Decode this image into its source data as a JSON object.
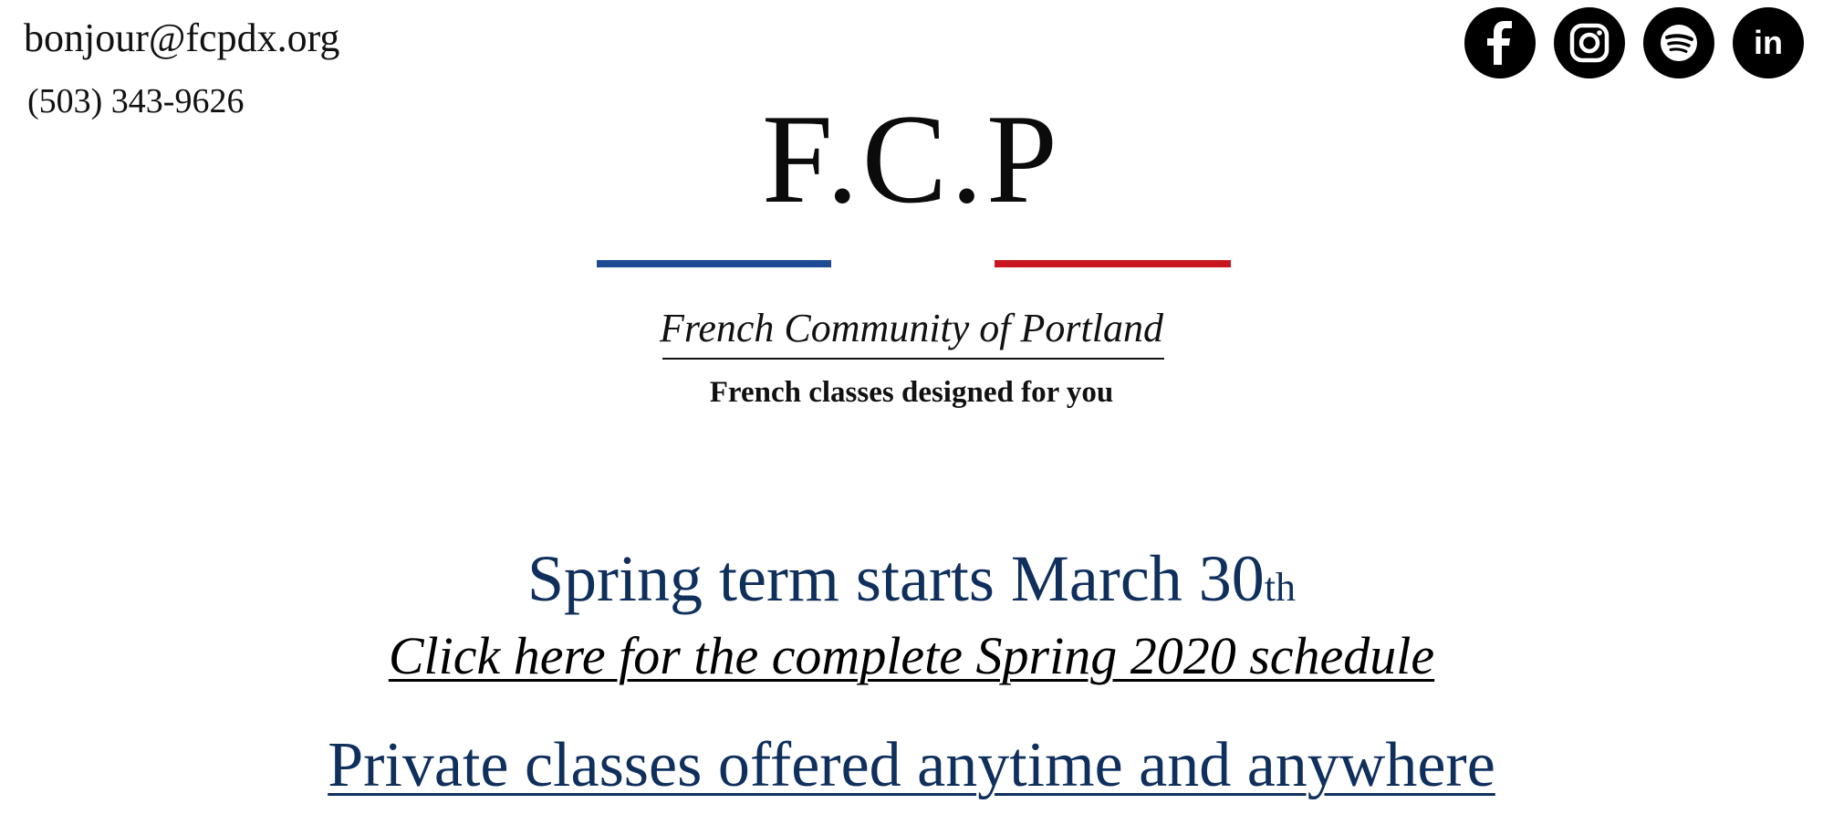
{
  "contact": {
    "email": "bonjour@fcpdx.org",
    "phone": "(503) 343-9626"
  },
  "social": {
    "icons": [
      "facebook-icon",
      "instagram-icon",
      "spotify-icon",
      "linkedin-icon"
    ],
    "linkedin_text": "in"
  },
  "brand": {
    "logo": "F.C.P",
    "tagline": "French Community of Portland",
    "subtagline": "French classes designed for you",
    "flag_blue": "#1f4a94",
    "flag_red": "#c8171f"
  },
  "main": {
    "headline": "Spring term starts March 30",
    "headline_suffix": "th",
    "schedule_link": "Click here for the complete Spring 2020 schedule",
    "private_link": "Private classes offered anytime and anywhere",
    "accent_color": "#0f2f5c"
  }
}
